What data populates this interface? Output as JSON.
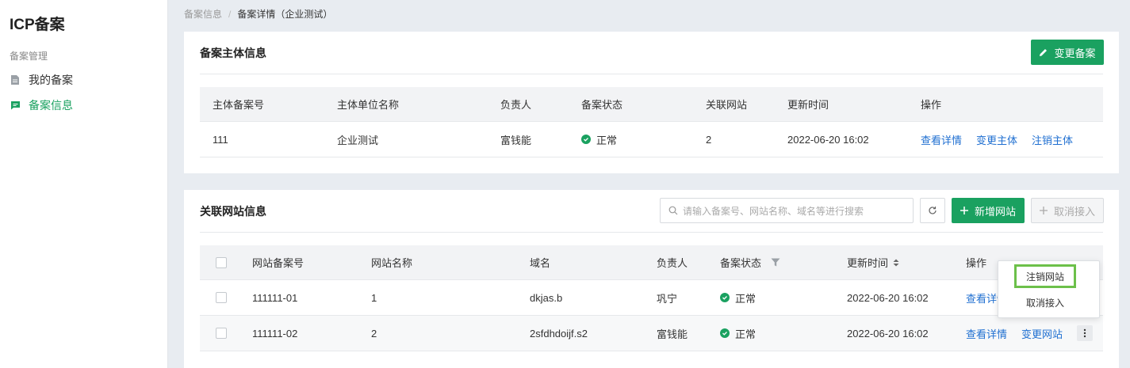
{
  "sidebar": {
    "app_title": "ICP备案",
    "section": "备案管理",
    "items": [
      {
        "label": "我的备案",
        "icon": "document-icon",
        "active": false
      },
      {
        "label": "备案信息",
        "icon": "message-icon",
        "active": true
      }
    ]
  },
  "breadcrumb": {
    "parent": "备案信息",
    "separator": "/",
    "current": "备案详情（企业测试）"
  },
  "colors": {
    "accent": "#1aa160",
    "link": "#1f6fd1",
    "highlight": "#6cc04a"
  },
  "entity": {
    "title": "备案主体信息",
    "change_button": "变更备案",
    "columns": [
      "主体备案号",
      "主体单位名称",
      "负责人",
      "备案状态",
      "关联网站",
      "更新时间",
      "操作"
    ],
    "row": {
      "record_no": "111",
      "company": "企业测试",
      "owner": "富钱能",
      "status": "正常",
      "sites": "2",
      "updated": "2022-06-20 16:02",
      "actions": [
        "查看详情",
        "变更主体",
        "注销主体"
      ]
    }
  },
  "websites": {
    "title": "关联网站信息",
    "search_placeholder": "请输入备案号、网站名称、域名等进行搜索",
    "add_button": "新增网站",
    "cancel_access_button": "取消接入",
    "columns": [
      "网站备案号",
      "网站名称",
      "域名",
      "负责人",
      "备案状态",
      "更新时间",
      "操作"
    ],
    "rows": [
      {
        "record_no": "111111-01",
        "name": "1",
        "domain": "dkjas.b",
        "owner": "巩宁",
        "status": "正常",
        "updated": "2022-06-20 16:02",
        "actions": [
          "查看详情"
        ]
      },
      {
        "record_no": "111111-02",
        "name": "2",
        "domain": "2sfdhdoijf.s2",
        "owner": "富钱能",
        "status": "正常",
        "updated": "2022-06-20 16:02",
        "actions": [
          "查看详情",
          "变更网站"
        ]
      }
    ]
  },
  "dropdown": {
    "items": [
      "注销网站",
      "取消接入"
    ]
  }
}
